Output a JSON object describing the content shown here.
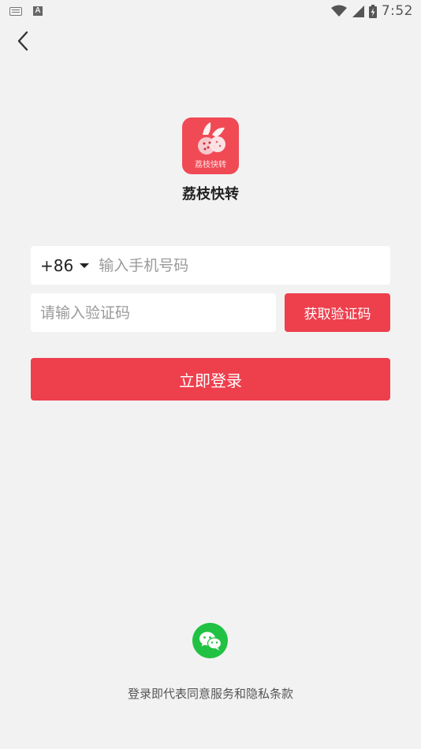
{
  "status_bar": {
    "time": "7:52",
    "icons": [
      "keyboard-icon",
      "a-icon",
      "wifi-icon",
      "cellular-signal-icon",
      "battery-charging-icon"
    ]
  },
  "nav": {
    "back_icon": "chevron-left-icon"
  },
  "app": {
    "name": "荔枝快转",
    "logo_text": "荔枝快转"
  },
  "form": {
    "country_code": "+86",
    "phone_placeholder": "输入手机号码",
    "code_placeholder": "请输入验证码",
    "get_code_label": "获取验证码",
    "login_label": "立即登录"
  },
  "social": {
    "wechat_icon": "wechat-icon"
  },
  "footer": {
    "agreement": "登录即代表同意服务和隐私条款"
  },
  "colors": {
    "background": "#f2f2f2",
    "accent": "#ee3f4d",
    "logo": "#f04a55",
    "wechat": "#21c243"
  }
}
